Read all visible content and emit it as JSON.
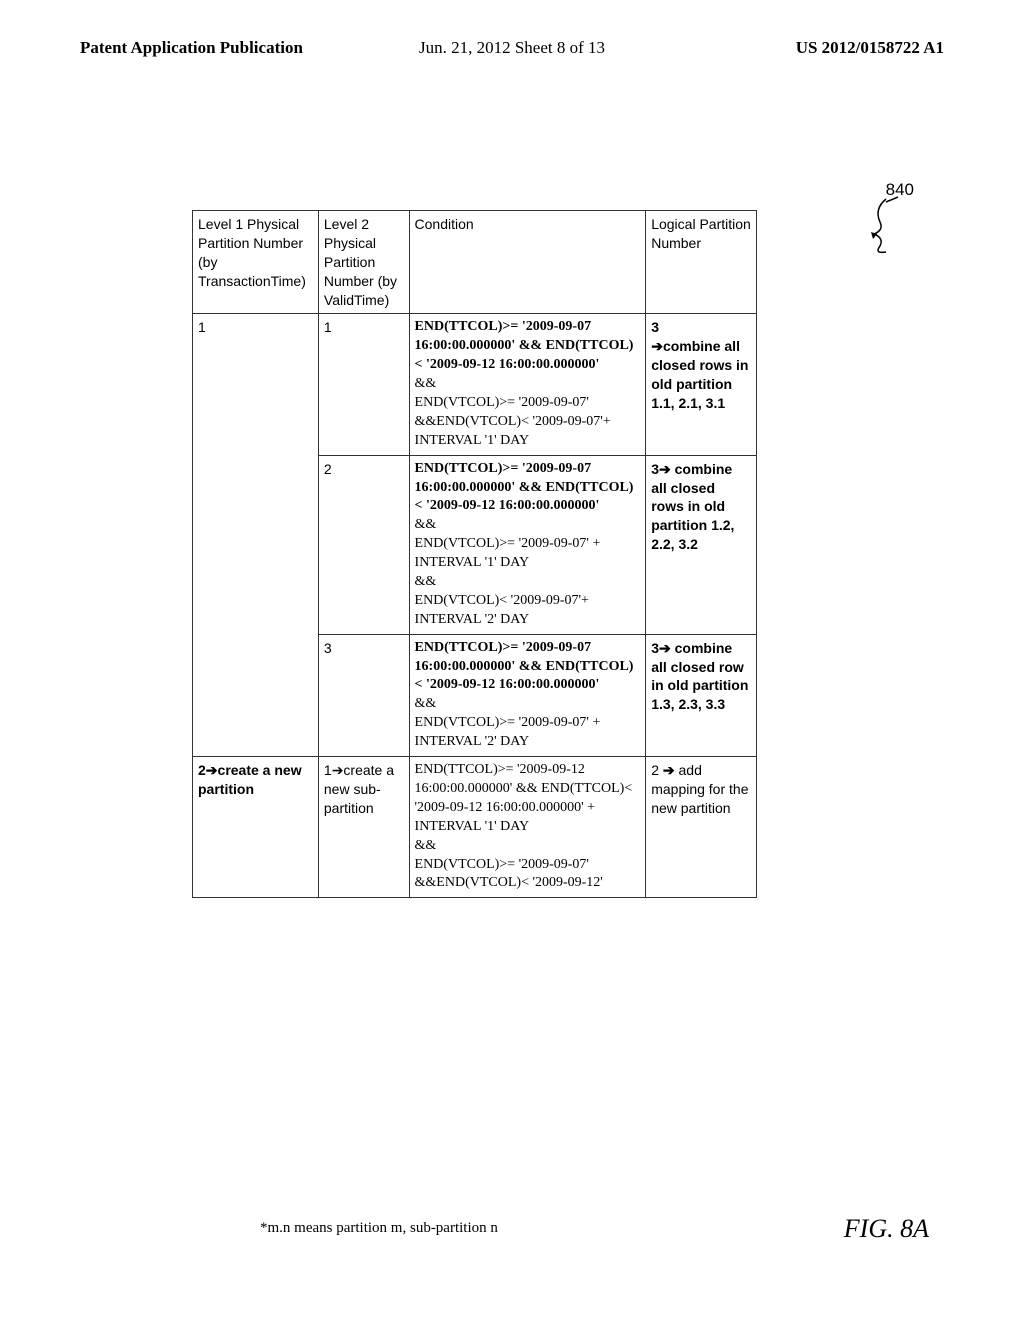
{
  "header": {
    "left": "Patent Application Publication",
    "center": "Jun. 21, 2012  Sheet 8 of 13",
    "right": "US 2012/0158722 A1"
  },
  "annotation_label": "840",
  "table": {
    "head": {
      "c1": "Level 1 Physical Partition Number (by TransactionTime)",
      "c2": "Level 2 Physical Partition Number (by ValidTime)",
      "c3": "Condition",
      "c4": "Logical Partition Number"
    },
    "r1": {
      "c1": "1",
      "c2": "1",
      "c3a": "END(TTCOL)>= '2009-09-07 16:00:00.000000' &&  END(TTCOL)< '2009-09-12 16:00:00.000000'",
      "c3b": "&&",
      "c3c": "END(VTCOL)>= '2009-09-07' &&END(VTCOL)< '2009-09-07'+ INTERVAL '1' DAY",
      "c4a": "3",
      "c4b": "combine all closed rows in old partition 1.1, 2.1, 3.1"
    },
    "r2": {
      "c2": "2",
      "c3a": "END(TTCOL)>= '2009-09-07 16:00:00.000000' &&  END(TTCOL)< '2009-09-12 16:00:00.000000'",
      "c3b": "&&",
      "c3c": "END(VTCOL)>= '2009-09-07' + INTERVAL '1' DAY",
      "c3d": "&&",
      "c3e": "END(VTCOL)< '2009-09-07'+ INTERVAL '2' DAY",
      "c4a": "3",
      "c4b": " combine all closed rows in old partition 1.2, 2.2, 3.2"
    },
    "r3": {
      "c2": "3",
      "c3a": "END(TTCOL)>= '2009-09-07 16:00:00.000000' &&  END(TTCOL)< '2009-09-12 16:00:00.000000'",
      "c3b": "&&",
      "c3c": "END(VTCOL)>= '2009-09-07' + INTERVAL '2' DAY",
      "c4a": "3",
      "c4b": " combine all closed row in old partition 1.3, 2.3, 3.3"
    },
    "r4": {
      "c1a": "2",
      "c1b": "create a new partition",
      "c2a": "1",
      "c2b": "create a new sub-partition",
      "c3a": "END(TTCOL)>= '2009-09-12 16:00:00.000000' &&  END(TTCOL)< '2009-09-12 16:00:00.000000' + INTERVAL '1' DAY",
      "c3b": "&&",
      "c3c": "END(VTCOL)>= '2009-09-07' &&END(VTCOL)< '2009-09-12'",
      "c4a": "2 ",
      "c4b": " add mapping for the new partition"
    }
  },
  "footnote": "*m.n means partition m, sub-partition n",
  "figure_label": "FIG. 8A"
}
